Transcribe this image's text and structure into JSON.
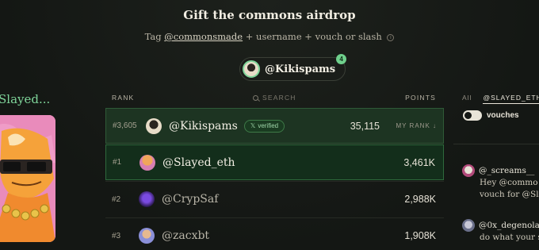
{
  "header": {
    "title": "Gift the commons airdrop",
    "subtitle_prefix": "Tag ",
    "subtitle_handle": "@commonsmade",
    "subtitle_suffix": " + username + vouch or slash"
  },
  "user_pill": {
    "name": "@Kikispams",
    "badge": "4"
  },
  "left_panel": {
    "title": "Slayed..."
  },
  "table": {
    "headers": {
      "rank": "RANK",
      "search": "SEARCH",
      "points": "POINTS"
    },
    "current_user": {
      "rank": "#3,605",
      "name": "@Kikispams",
      "verified": "verified",
      "points": "35,115",
      "my_rank": "MY RANK ↓"
    },
    "rows": [
      {
        "rank": "#1",
        "name": "@Slayed_eth",
        "points": "3,461K"
      },
      {
        "rank": "#2",
        "name": "@CrypSaf",
        "points": "2,988K"
      },
      {
        "rank": "#3",
        "name": "@zacxbt",
        "points": "1,908K"
      }
    ]
  },
  "side": {
    "tabs": [
      "All",
      "@SLAYED_ETH"
    ],
    "toggle_label": "vouches",
    "feed": [
      {
        "user": "@_screams__",
        "lines": [
          "Hey @commo",
          "vouch for @Sl"
        ]
      },
      {
        "user": "@0x_degenola",
        "lines": [
          "do what your s",
          "..."
        ]
      }
    ]
  },
  "colors": {
    "accent_green": "#7fd59a",
    "row_highlight": "#132e1b",
    "background": "#141714"
  }
}
